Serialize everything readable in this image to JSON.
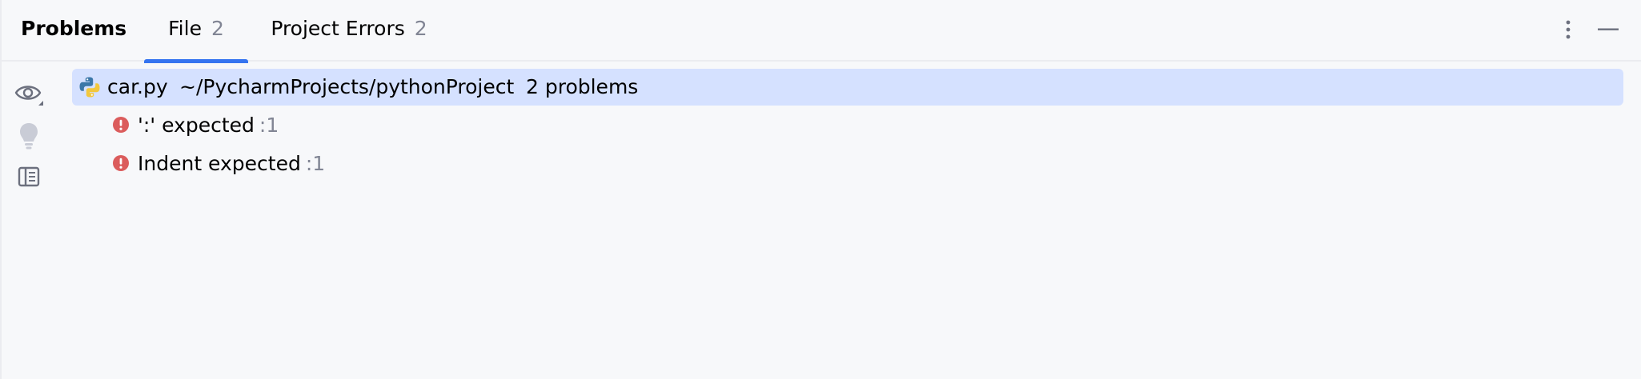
{
  "header": {
    "title": "Problems",
    "tabs": [
      {
        "label": "File",
        "count": "2",
        "selected": true
      },
      {
        "label": "Project Errors",
        "count": "2",
        "selected": false
      }
    ],
    "more_icon": "more-vertical-icon",
    "minimize_icon": "minimize-icon"
  },
  "toolbar": {
    "items": [
      {
        "icon": "eye-icon"
      },
      {
        "icon": "lightbulb-icon"
      },
      {
        "icon": "preview-panel-icon"
      }
    ]
  },
  "tree": {
    "file": {
      "icon": "python-file-icon",
      "name": "car.py",
      "path": "~/PycharmProjects/pythonProject",
      "problems": "2 problems"
    },
    "problems": [
      {
        "icon": "error-icon",
        "message": "':' expected",
        "location": ":1"
      },
      {
        "icon": "error-icon",
        "message": "Indent expected",
        "location": ":1"
      }
    ]
  },
  "colors": {
    "background": "#f7f8fa",
    "selection": "#d5e1ff",
    "accent": "#3574f0",
    "error": "#db5c5c",
    "muted_text": "#818594",
    "border": "#ebecf0"
  }
}
